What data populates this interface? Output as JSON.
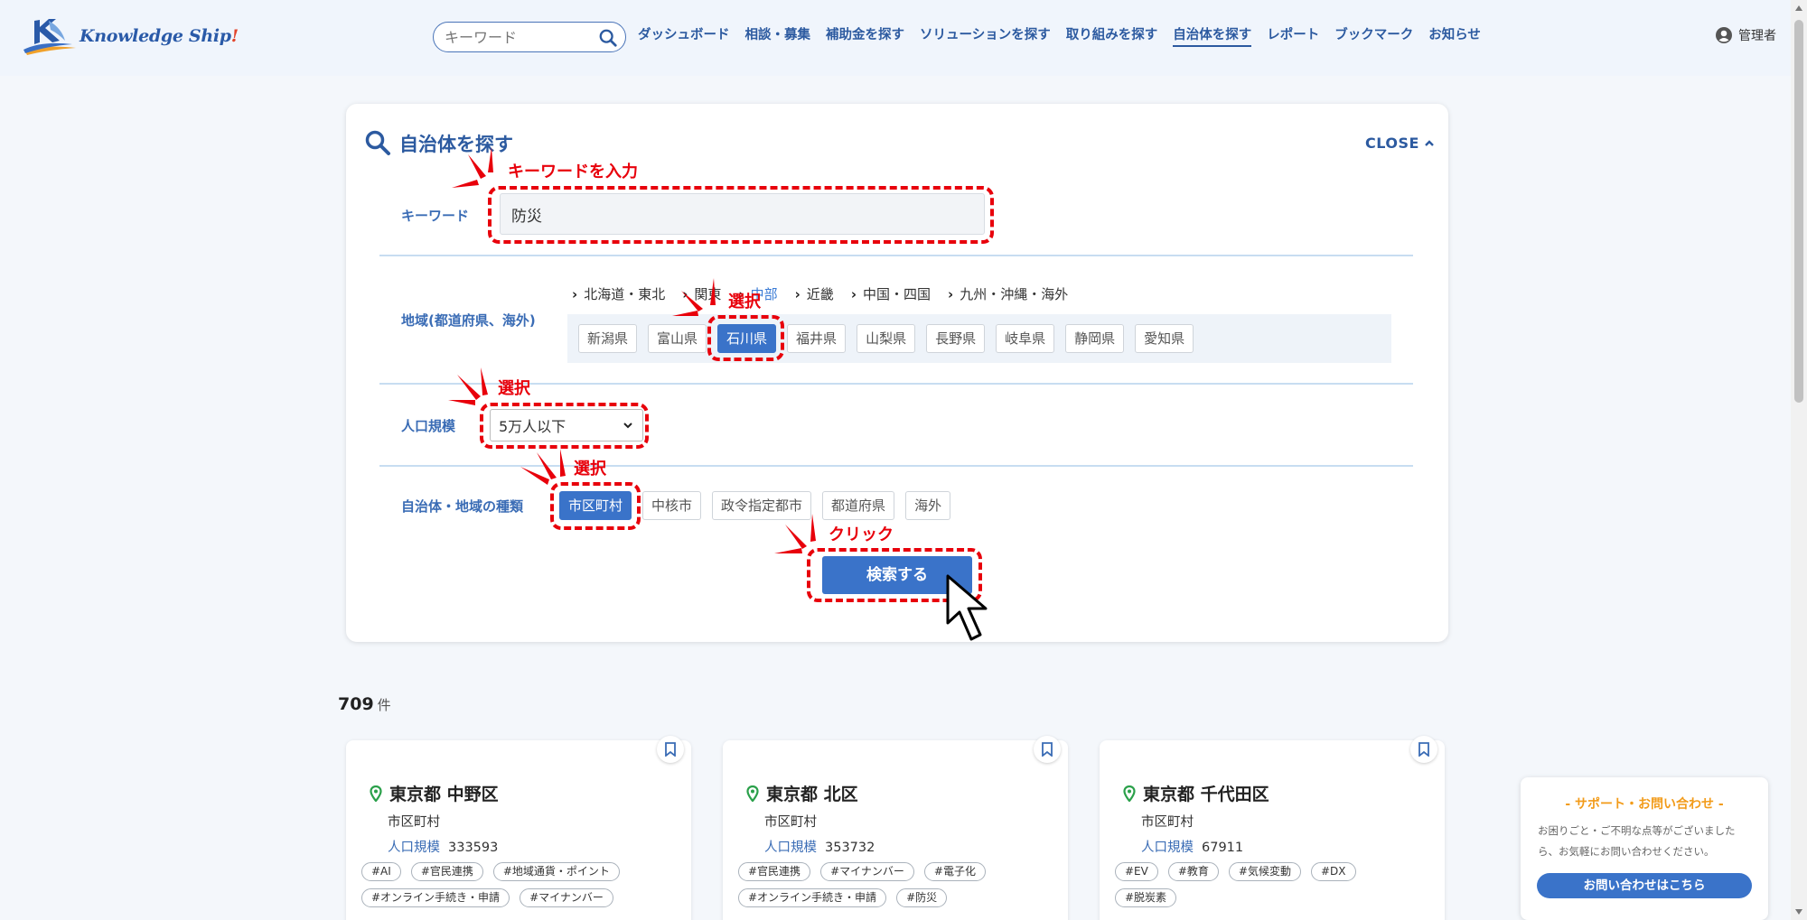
{
  "header": {
    "logo_text_main": "Knowledge Ship",
    "logo_text_mark": "!",
    "search_placeholder": "キーワード",
    "nav": [
      "ダッシュボード",
      "相談・募集",
      "補助金を探す",
      "ソリューションを探す",
      "取り組みを探す",
      "自治体を探す",
      "レポート",
      "ブックマーク",
      "お知らせ"
    ],
    "nav_active_index": 5,
    "user_label": "管理者"
  },
  "panel": {
    "title": "自治体を探す",
    "close_label": "CLOSE",
    "keyword_label": "キーワード",
    "keyword_value": "防災",
    "region_label": "地域(都道府県、海外)",
    "region_tabs": [
      "北海道・東北",
      "関東",
      "中部",
      "近畿",
      "中国・四国",
      "九州・沖縄・海外"
    ],
    "region_active": "中部",
    "prefectures": [
      "新潟県",
      "富山県",
      "石川県",
      "福井県",
      "山梨県",
      "長野県",
      "岐阜県",
      "静岡県",
      "愛知県"
    ],
    "prefecture_selected": "石川県",
    "population_label": "人口規模",
    "population_value": "5万人以下",
    "type_label": "自治体・地域の種類",
    "types": [
      "市区町村",
      "中核市",
      "政令指定都市",
      "都道府県",
      "海外"
    ],
    "type_selected": "市区町村",
    "search_button": "検索する"
  },
  "annotations": {
    "keyword": "キーワードを入力",
    "select1": "選択",
    "select2": "選択",
    "select3": "選択",
    "click": "クリック"
  },
  "results": {
    "count": "709",
    "count_unit": "件",
    "population_label": "人口規模",
    "cards": [
      {
        "title": "東京都 中野区",
        "type": "市区町村",
        "population": "333593",
        "tags": [
          "#AI",
          "#官民連携",
          "#地域通貨・ポイント",
          "#オンライン手続き・申請",
          "#マイナンバー"
        ]
      },
      {
        "title": "東京都 北区",
        "type": "市区町村",
        "population": "353732",
        "tags": [
          "#官民連携",
          "#マイナンバー",
          "#電子化",
          "#オンライン手続き・申請",
          "#防災"
        ]
      },
      {
        "title": "東京都 千代田区",
        "type": "市区町村",
        "population": "67911",
        "tags": [
          "#EV",
          "#教育",
          "#気候変動",
          "#DX",
          "#脱炭素"
        ]
      }
    ]
  },
  "support": {
    "title": "- サポート・お問い合わせ -",
    "text": "お困りごと・ご不明な点等がございましたら、お気軽にお問い合わせください。",
    "button": "お問い合わせはこちら"
  },
  "colors": {
    "brand_blue": "#2c5aa0",
    "accent_blue": "#3a73c9",
    "annotation_red": "#e8000b",
    "support_orange": "#f29b19"
  }
}
